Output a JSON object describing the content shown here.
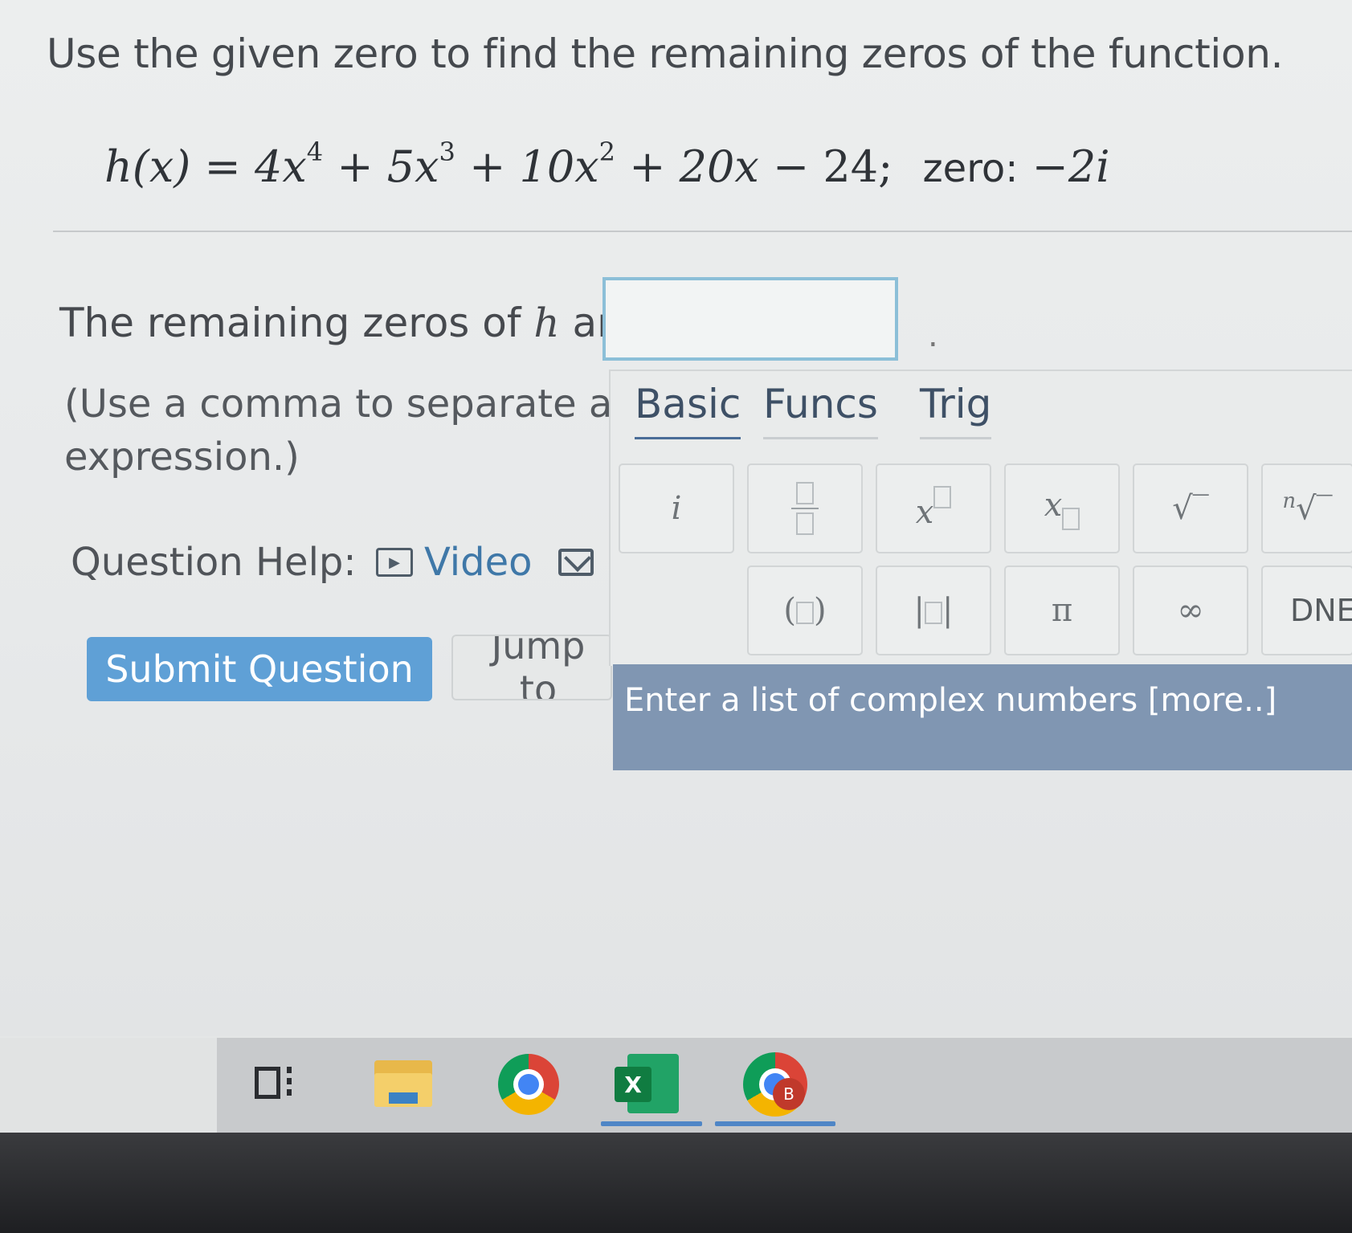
{
  "question": {
    "prompt": "Use the given zero to find the remaining zeros of the function.",
    "equation": {
      "lhs": "h(x)",
      "equals": "=",
      "t1_coef": "4x",
      "t1_exp": "4",
      "op1": "+",
      "t2_coef": "5x",
      "t2_exp": "3",
      "op2": "+",
      "t3_coef": "10x",
      "t3_exp": "2",
      "op3": "+",
      "t4": "20x",
      "op4": "−",
      "t5": "24;",
      "zero_label": "zero:",
      "zero_value": "−2i"
    }
  },
  "answer": {
    "label_prefix": "The remaining zeros of",
    "label_var": "h",
    "label_suffix": "are",
    "input_value": "",
    "period": "."
  },
  "hint": {
    "line1": "(Use a comma to separate an",
    "line2": "expression.)"
  },
  "help": {
    "label": "Question Help:",
    "video_label": "Video",
    "video_icon": "play-icon",
    "message_icon": "mail-icon"
  },
  "buttons": {
    "submit": "Submit Question",
    "jump": "Jump to"
  },
  "palette": {
    "tabs": [
      {
        "label": "Basic",
        "active": true
      },
      {
        "label": "Funcs",
        "active": false
      },
      {
        "label": "Trig",
        "active": false
      }
    ],
    "keys": {
      "imag": "i",
      "pi": "π",
      "infinity": "∞",
      "dne": "DNE",
      "nth_root_index": "n"
    },
    "tooltip": "Enter a list of complex numbers [more..]"
  },
  "taskbar": {
    "apps": [
      "task-view",
      "file-explorer",
      "chrome",
      "excel",
      "chrome-profile"
    ],
    "excel_letter": "X",
    "profile_letter": "B"
  },
  "colors": {
    "accent": "#5fa0d6",
    "tooltip": "#8096b2",
    "link": "#3f78a8"
  }
}
